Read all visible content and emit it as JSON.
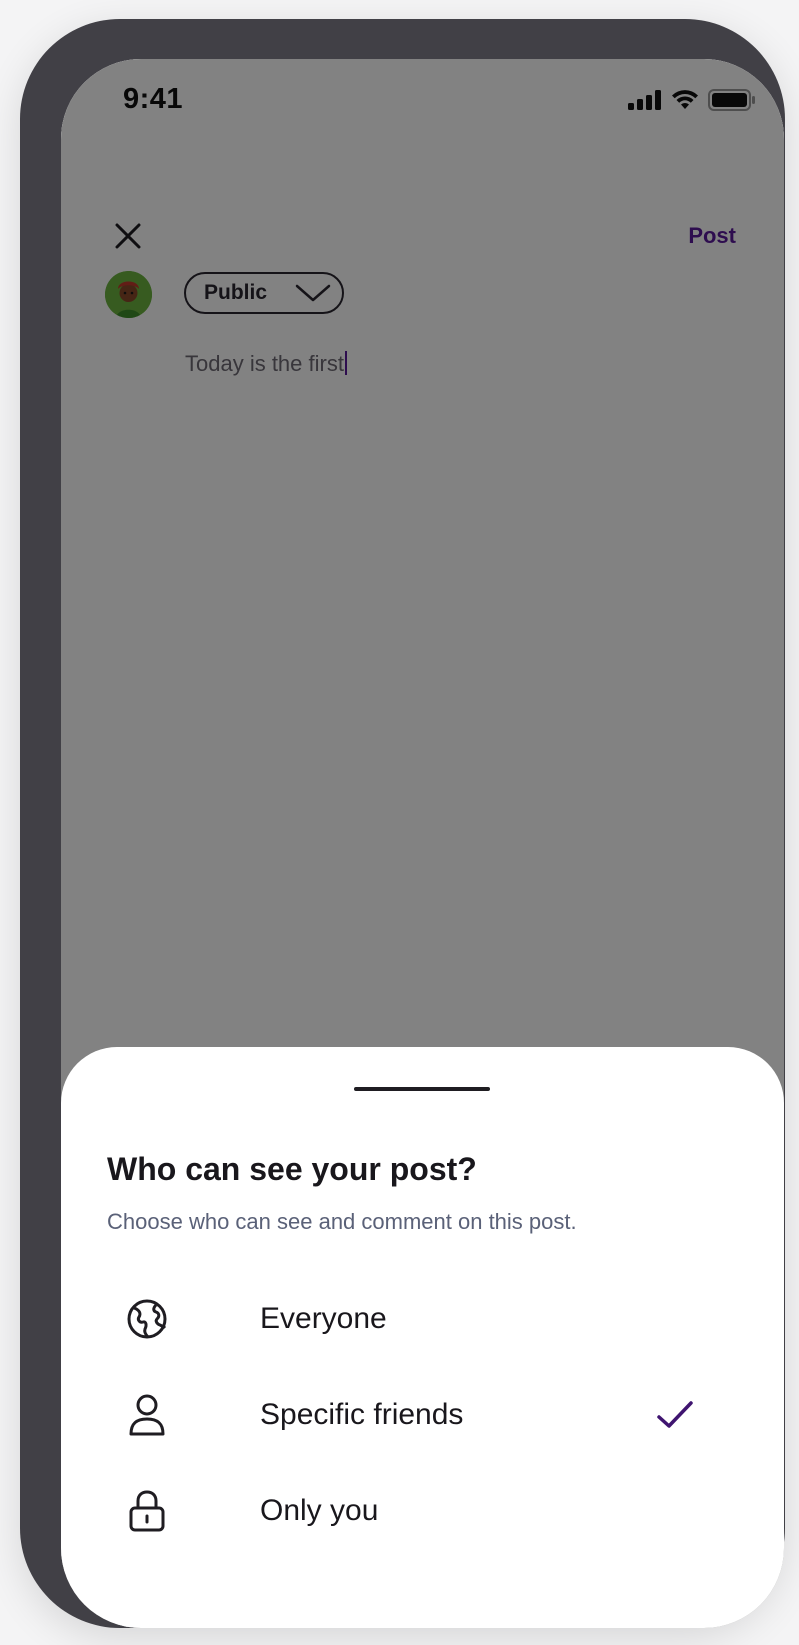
{
  "status_bar": {
    "time": "9:41"
  },
  "composer": {
    "close_icon": "close-icon",
    "post_label": "Post",
    "audience_label": "Public",
    "text": "Today is the first"
  },
  "sheet": {
    "title": "Who can see your post?",
    "subtitle": "Choose who can see and comment on this post.",
    "options": [
      {
        "label": "Everyone",
        "icon": "globe-icon",
        "selected": false
      },
      {
        "label": "Specific friends",
        "icon": "person-icon",
        "selected": true
      },
      {
        "label": "Only you",
        "icon": "lock-icon",
        "selected": false
      }
    ]
  },
  "colors": {
    "accent": "#5b1a9c",
    "frame": "#414046",
    "text": "#19171c",
    "subtext": "#5a6178"
  }
}
